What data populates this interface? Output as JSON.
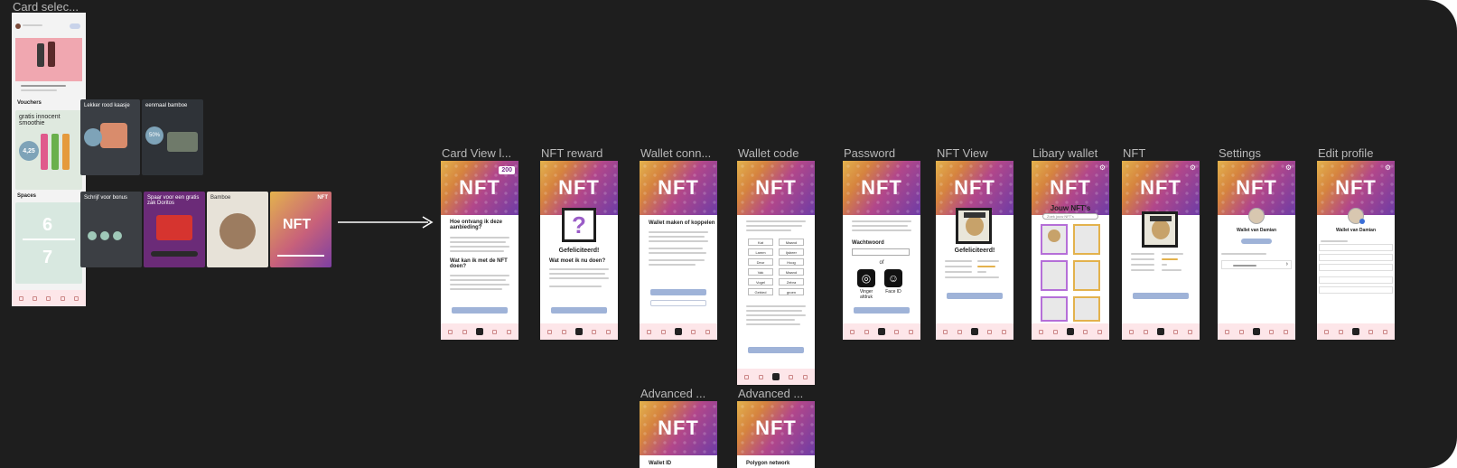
{
  "frames": [
    {
      "label": "Card selec..."
    },
    {
      "label": "Card View l..."
    },
    {
      "label": "NFT reward"
    },
    {
      "label": "Wallet conn..."
    },
    {
      "label": "Wallet code"
    },
    {
      "label": "Password"
    },
    {
      "label": "NFT View"
    },
    {
      "label": "Libary wallet"
    },
    {
      "label": "NFT"
    },
    {
      "label": "Settings"
    },
    {
      "label": "Edit profile"
    },
    {
      "label": "Advanced ..."
    },
    {
      "label": "Advanced ..."
    }
  ],
  "brand": {
    "logo_text": "NFT",
    "badge": "200",
    "accent": "#9fb3d8",
    "gradient_start": "#e3b24d",
    "gradient_end": "#6d3ca6"
  },
  "card_select": {
    "vouchers_heading": "Vouchers",
    "spaces_heading": "Spaces",
    "voucher_cards": [
      "gratis innocent smoothie",
      "Lekker rood kaasje",
      "eenmaal bamboe"
    ],
    "spaces_cards": [
      "Schrijf voor bonus",
      "Spaar voor een gratis zak Doritos",
      "Bamboe",
      "NFT"
    ],
    "big_numbers": [
      "6",
      "7"
    ],
    "price": "4,25",
    "discount": "50%"
  },
  "screens": {
    "card_view": {
      "heading": "Hoe ontvang ik deze aanbieding?",
      "subheading": "Wat kan ik met de NFT doen?"
    },
    "nft_reward": {
      "title": "Gefeliciteerd!",
      "question": "?",
      "subtitle": "Wat moet ik nu doen?"
    },
    "wallet_connect": {
      "heading": "Wallet maken of koppelen"
    },
    "wallet_code": {
      "words": [
        "Kat",
        "Maand",
        "Lamm",
        "Ijsbeer",
        "Deur",
        "Hoog",
        "Vak",
        "Maand",
        "Vogel",
        "Zebra",
        "Gebied",
        "groen"
      ]
    },
    "password": {
      "label": "Wachtwoord",
      "or": "of",
      "fingerprint": "Vinger afdruk",
      "face": "Face ID"
    },
    "nft_view": {
      "title": "Gefeliciteerd!"
    },
    "library": {
      "title": "Jouw NFT's",
      "search_placeholder": "Zoek jouw NFT's"
    },
    "settings": {
      "name": "Wallet van Damian"
    },
    "edit_profile": {
      "name": "Wallet van Damian"
    },
    "advanced_1": {
      "heading": "Wallet ID"
    },
    "advanced_2": {
      "heading": "Polygon network"
    }
  },
  "arrow": {
    "icon": "arrow-right-icon"
  }
}
